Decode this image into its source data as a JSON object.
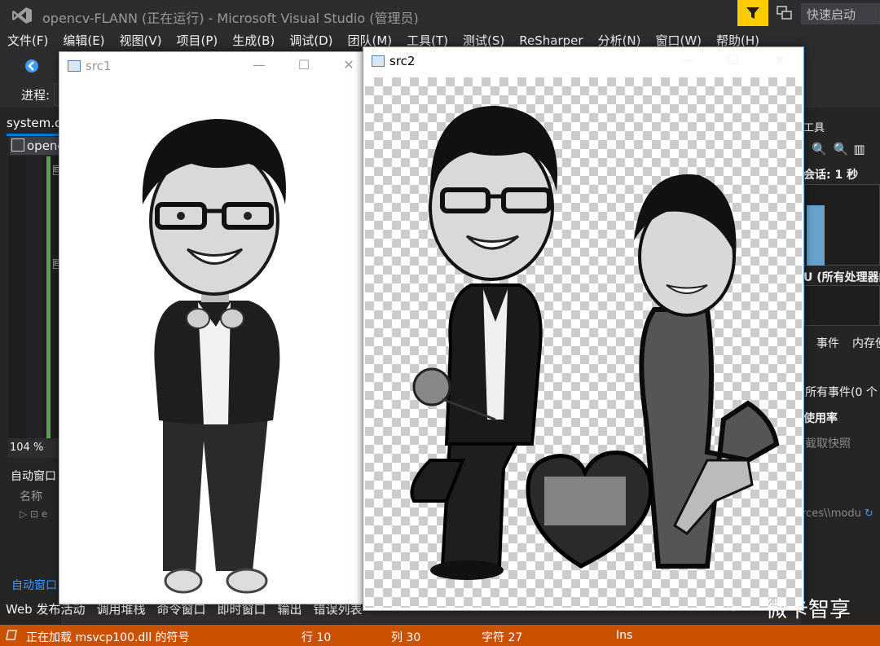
{
  "titlebar": {
    "title": "opencv-FLANN (正在运行) - Microsoft Visual Studio (管理员)",
    "quick_launch_placeholder": "快速启动"
  },
  "menu": [
    "文件(F)",
    "编辑(E)",
    "视图(V)",
    "项目(P)",
    "生成(B)",
    "调试(D)",
    "团队(M)",
    "工具(T)",
    "测试(S)",
    "ReSharper",
    "分析(N)",
    "窗口(W)",
    "帮助(H)"
  ],
  "toolbar": {
    "process_label": "进程:"
  },
  "editor": {
    "doc_tab": "system.c",
    "file_tab": "openc",
    "zoom": "104 %"
  },
  "autos": {
    "title": "自动窗口",
    "column_name": "名称",
    "row_text": "e",
    "tab_label": "自动窗口"
  },
  "bottom_tabs": [
    "Web 发布活动",
    "调用堆栈",
    "命令窗口",
    "即时窗口",
    "输出",
    "错误列表"
  ],
  "status": {
    "message": "正在加载 msvcp100.dll 的符号",
    "line": "行 10",
    "col": "列 30",
    "char": "字符 27",
    "mode": "Ins"
  },
  "diag": {
    "tools": "工具",
    "session": "会话: 1 秒",
    "cpu": "U (所有处理器的",
    "events_tab": "事件",
    "memory_tab": "内存使",
    "all_events": "所有事件(0 个",
    "usage": "使用率",
    "snapshot": "截取快照",
    "path": "rces\\\\modu"
  },
  "windows": {
    "src1": {
      "title": "src1"
    },
    "src2": {
      "title": "src2"
    }
  },
  "watermark": {
    "text": "微卡智享"
  },
  "colors": {
    "status_bar": "#ca5100",
    "accent": "#007acc",
    "filter": "#ffcc00"
  }
}
